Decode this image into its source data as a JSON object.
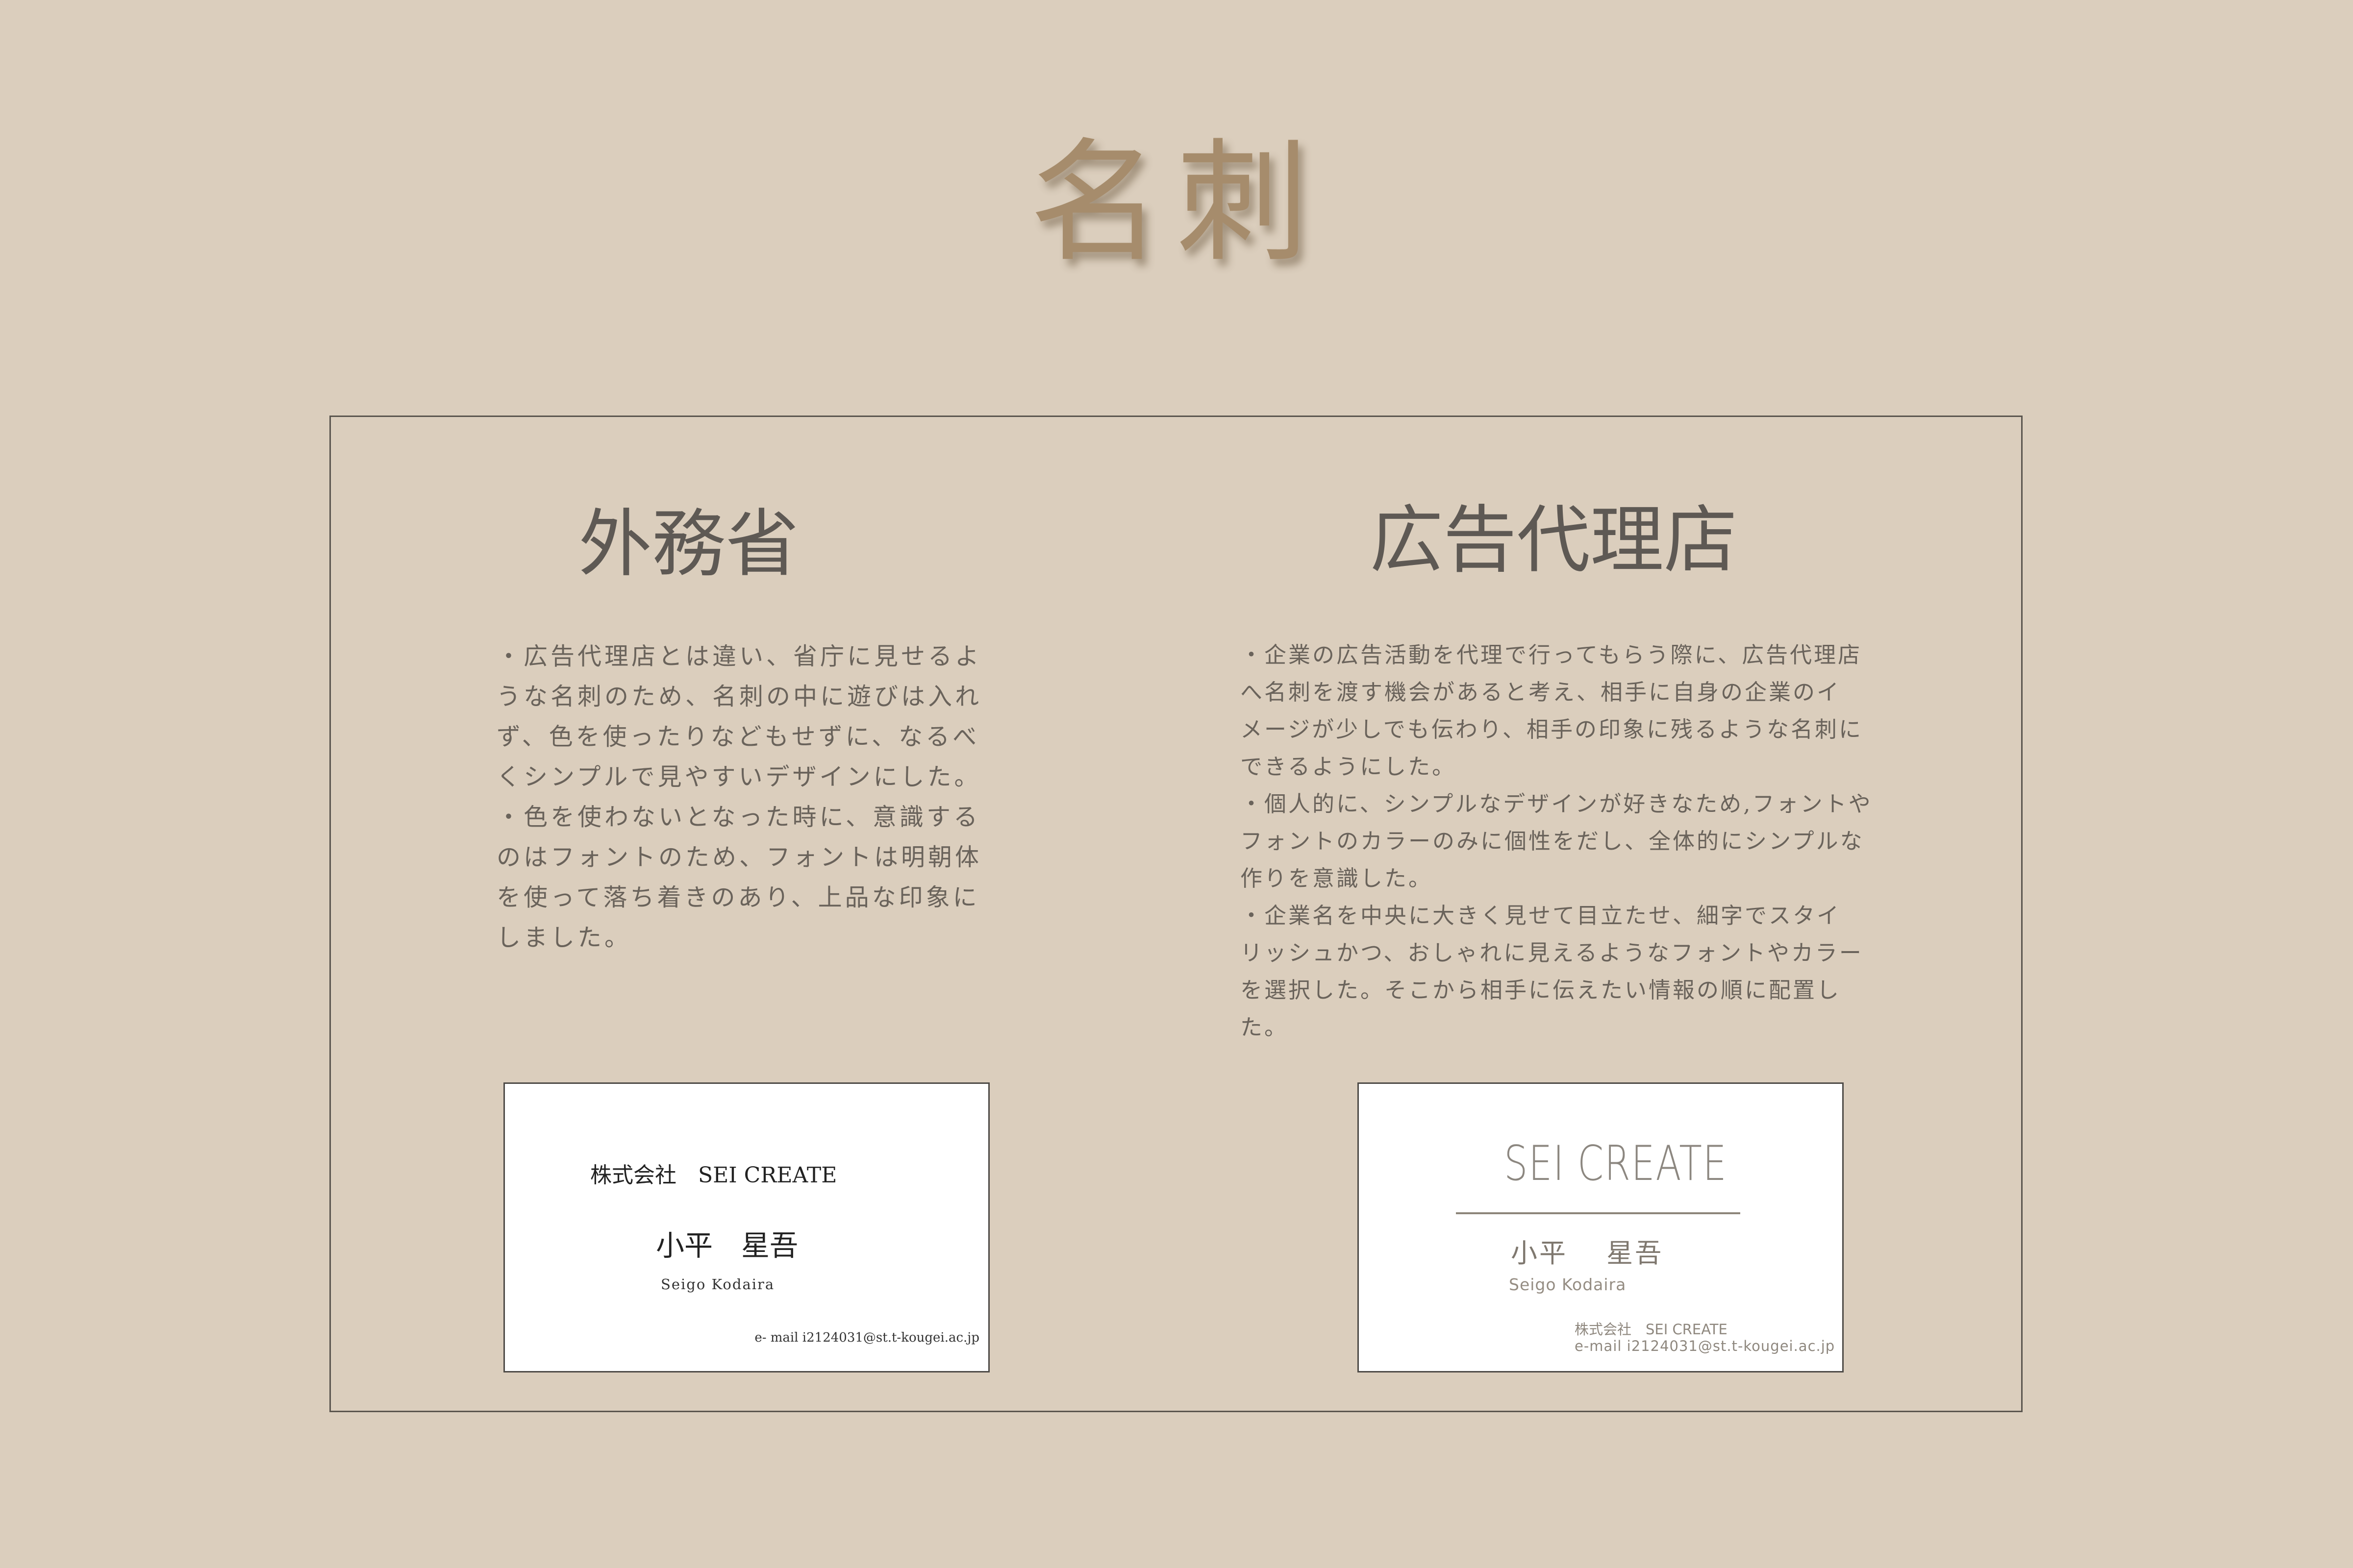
{
  "page": {
    "title": "名刺"
  },
  "sections": {
    "left": {
      "heading": "外務省",
      "description": "・広告代理店とは違い、省庁に見せるよ\nうな名刺のため、名刺の中に遊びは入れ\nず、色を使ったりなどもせずに、なるべ\nくシンプルで見やすいデザインにした。\n・色を使わないとなった時に、意識する\nのはフォントのため、フォントは明朝体\nを使って落ち着きのあり、上品な印象に\nしました。",
      "card": {
        "company": "株式会社　SEI CREATE",
        "name": "小平　星吾",
        "roman_name": "Seigo Kodaira",
        "email": "e- mail i2124031@st.t-kougei.ac.jp"
      }
    },
    "right": {
      "heading": "広告代理店",
      "description": "・企業の広告活動を代理で行ってもらう際に、広告代理店\nへ名刺を渡す機会があると考え、相手に自身の企業のイ\nメージが少しでも伝わり、相手の印象に残るような名刺に\nできるようにした。\n・個人的に、シンプルなデザインが好きなため,フォントや\nフォントのカラーのみに個性をだし、全体的にシンプルな\n作りを意識した。\n・企業名を中央に大きく見せて目立たせ、細字でスタイ\nリッシュかつ、おしゃれに見えるようなフォントやカラー\nを選択した。そこから相手に伝えたい情報の順に配置し\nた。",
      "card": {
        "logo": "SEI CREATE",
        "name": "小平　 星吾",
        "roman_name": "Seigo Kodaira",
        "company": "株式会社　SEI CREATE",
        "email": "e-mail  i2124031@st.t-kougei.ac.jp"
      }
    }
  },
  "colors": {
    "background": "#dbcebd",
    "title": "#a68c6c",
    "heading": "#5e5954",
    "body_text": "#6a635b",
    "card_background": "#ffffff",
    "card_border": "#4e4b47",
    "right_card_text": "#8f887f"
  }
}
